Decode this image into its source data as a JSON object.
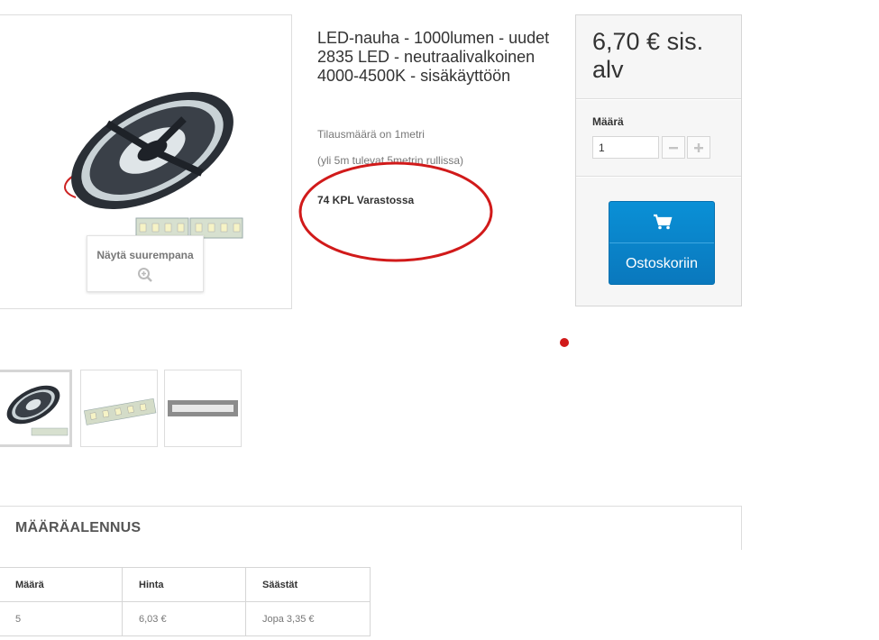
{
  "product": {
    "title": "LED-nauha - 1000lumen - uudet 2835 LED - neutraalivalkoinen 4000-4500K - sisäkäyttöön",
    "order_note": "Tilausmäärä on 1metri",
    "roll_note": "(yli 5m tulevat 5metrin rullissa)",
    "stock": "74 KPL Varastossa",
    "zoom_label": "Näytä suurempana",
    "image_icon": "led-strip-reel"
  },
  "price_box": {
    "price": "6,70 € sis. alv",
    "qty_label": "Määrä",
    "qty_value": "1",
    "minus_icon": "minus-icon",
    "plus_icon": "plus-icon",
    "cart_label": "Ostoskoriin",
    "cart_icon": "shopping-cart-icon",
    "cart_color": "#0a84ca"
  },
  "thumbnails": [
    {
      "name": "led-reel-thumbnail",
      "active": true
    },
    {
      "name": "led-strip-thumbnail",
      "active": false
    },
    {
      "name": "led-strip-lit-thumbnail",
      "active": false
    }
  ],
  "discount": {
    "title": "MÄÄRÄALENNUS",
    "headers": [
      "Määrä",
      "Hinta",
      "Säästät"
    ],
    "rows": [
      [
        "5",
        "6,03 €",
        "Jopa 3,35 €"
      ]
    ]
  },
  "annotation_color": "#d11a1a"
}
